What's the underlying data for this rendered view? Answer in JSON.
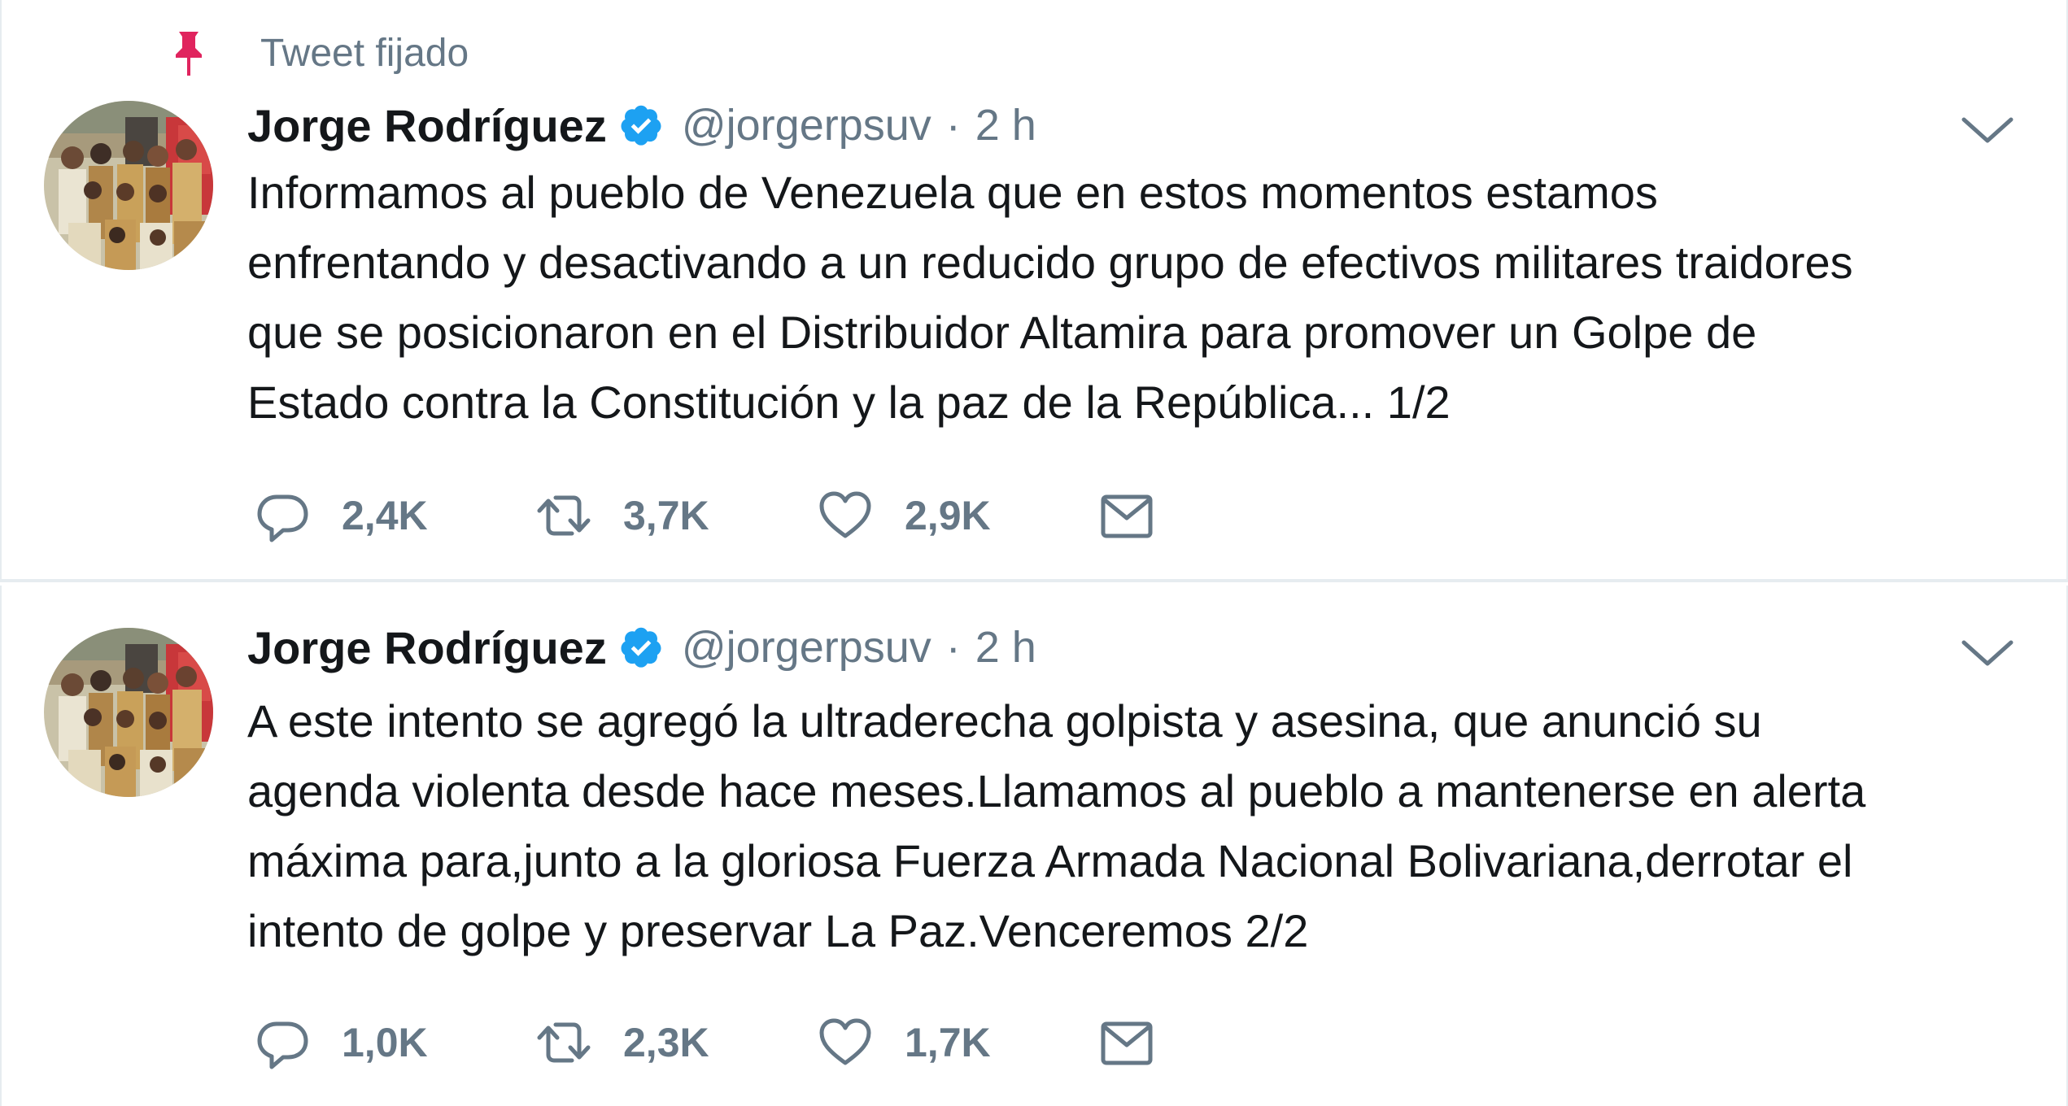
{
  "pinned_label": "Tweet fijado",
  "colors": {
    "pin": "#e0245e",
    "verified": "#1da1f2",
    "secondary_text": "#657786",
    "primary_text": "#14171a",
    "divider": "#e6ecf0"
  },
  "icons": [
    "pin-icon",
    "verified-icon",
    "chevron-down-icon",
    "reply-icon",
    "retweet-icon",
    "like-icon",
    "envelope-icon"
  ],
  "tweets": [
    {
      "display_name": "Jorge Rodríguez",
      "handle": "@jorgerpsuv",
      "separator": "·",
      "time": "2 h",
      "text_lines": [
        "Informamos al pueblo de Venezuela que en estos momentos estamos",
        "enfrentando y desactivando a un reducido grupo de efectivos militares traidores",
        "que se posicionaron en el Distribuidor Altamira para promover un Golpe de",
        "Estado contra la Constitución y la paz de la República... 1/2"
      ],
      "replies": "2,4K",
      "retweets": "3,7K",
      "likes": "2,9K"
    },
    {
      "display_name": "Jorge Rodríguez",
      "handle": "@jorgerpsuv",
      "separator": "·",
      "time": "2 h",
      "text_lines": [
        "A este intento se agregó la ultraderecha golpista y asesina, que anunció su",
        "agenda violenta desde hace meses.Llamamos al pueblo a mantenerse en alerta",
        "máxima para,junto a la gloriosa Fuerza Armada Nacional Bolivariana,derrotar el",
        "intento de golpe y preservar La Paz.Venceremos 2/2"
      ],
      "replies": "1,0K",
      "retweets": "2,3K",
      "likes": "1,7K"
    }
  ]
}
